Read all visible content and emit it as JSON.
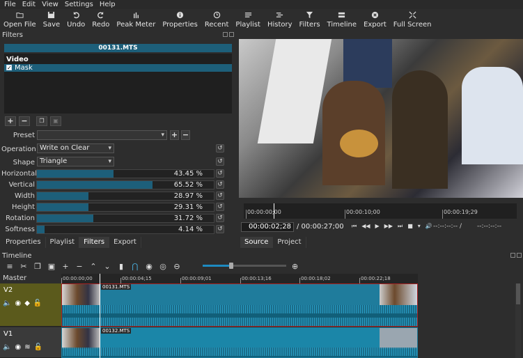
{
  "menu": [
    "File",
    "Edit",
    "View",
    "Settings",
    "Help"
  ],
  "toolbar": [
    {
      "label": "Open File",
      "icon": "open-file-icon"
    },
    {
      "label": "Save",
      "icon": "save-icon"
    },
    {
      "label": "Undo",
      "icon": "undo-icon"
    },
    {
      "label": "Redo",
      "icon": "redo-icon"
    },
    {
      "label": "Peak Meter",
      "icon": "peak-meter-icon"
    },
    {
      "label": "Properties",
      "icon": "properties-icon"
    },
    {
      "label": "Recent",
      "icon": "recent-icon"
    },
    {
      "label": "Playlist",
      "icon": "playlist-icon"
    },
    {
      "label": "History",
      "icon": "history-icon"
    },
    {
      "label": "Filters",
      "icon": "filters-icon"
    },
    {
      "label": "Timeline",
      "icon": "timeline-icon"
    },
    {
      "label": "Export",
      "icon": "export-icon"
    },
    {
      "label": "Full Screen",
      "icon": "full-screen-icon"
    }
  ],
  "filters": {
    "title": "Filters",
    "clip_name": "00131.MTS",
    "category": "Video",
    "items": [
      {
        "name": "Mask",
        "checked": true
      }
    ],
    "preset_label": "Preset",
    "preset_value": "",
    "operation_label": "Operation",
    "operation_value": "Write on Clear",
    "shape_label": "Shape",
    "shape_value": "Triangle",
    "params": [
      {
        "label": "Horizontal",
        "value": "43.45 %",
        "fraction": 0.4345
      },
      {
        "label": "Vertical",
        "value": "65.52 %",
        "fraction": 0.6552
      },
      {
        "label": "Width",
        "value": "28.97 %",
        "fraction": 0.2897
      },
      {
        "label": "Height",
        "value": "29.31 %",
        "fraction": 0.2931
      },
      {
        "label": "Rotation",
        "value": "31.72 %",
        "fraction": 0.3172
      },
      {
        "label": "Softness",
        "value": "4.14 %",
        "fraction": 0.0414
      }
    ]
  },
  "left_tabs": [
    "Properties",
    "Playlist",
    "Filters",
    "Export"
  ],
  "left_tab_active": "Filters",
  "player": {
    "ruler_labels": [
      "00:00:00;00",
      "00:00:10;00",
      "00:00:19;29"
    ],
    "current_tc": "00:00:02;28",
    "total_tc": "/ 00:00:27;00",
    "in_point": "--:--:--:-- /",
    "out_point": "--:--:--:--",
    "transport": [
      "⏮",
      "◀◀",
      "▶",
      "▶▶",
      "⏭",
      "■",
      "▾",
      "🔊"
    ]
  },
  "right_tabs": [
    "Source",
    "Project"
  ],
  "right_tab_active": "Source",
  "timeline": {
    "title": "Timeline",
    "master_label": "Master",
    "ruler_labels": [
      "00:00:00;00",
      "00:00:04;15",
      "00:00:09;01",
      "00:00:13;16",
      "00:00:18;02",
      "00:00:22;18"
    ],
    "tracks": [
      {
        "name": "V2",
        "clip": "00131.MTS"
      },
      {
        "name": "V1",
        "clip": "00132.MTS"
      }
    ]
  }
}
